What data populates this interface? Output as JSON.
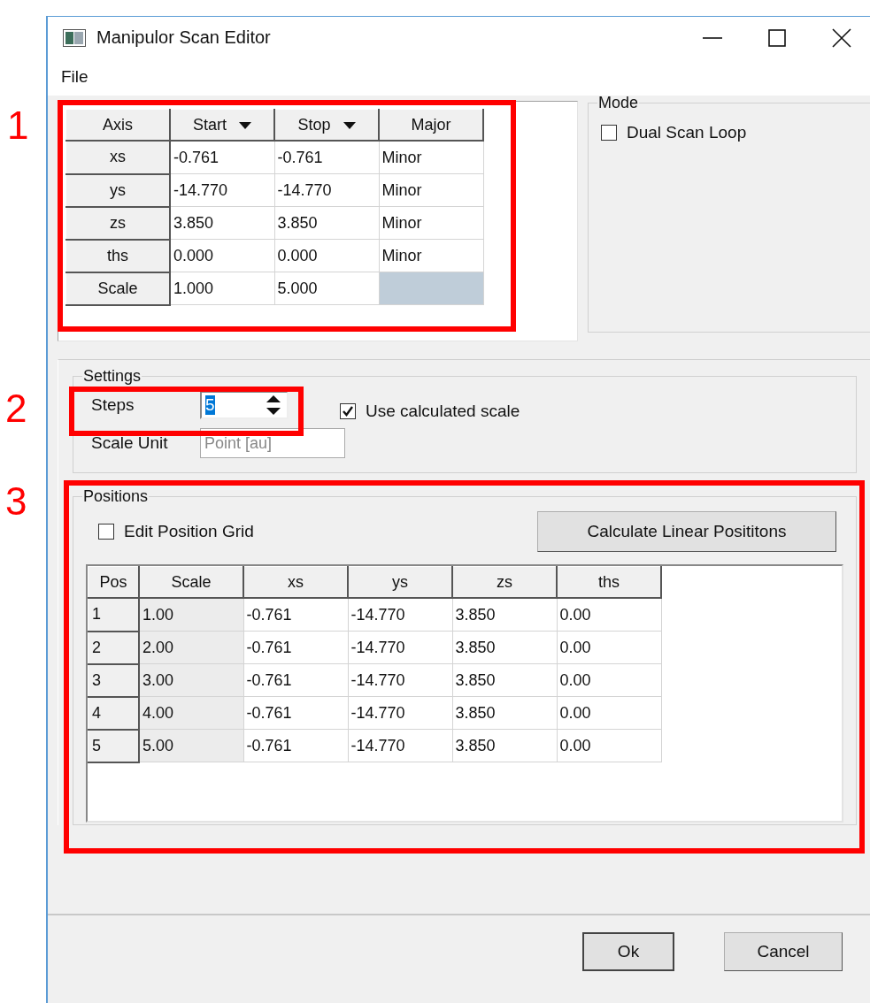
{
  "window": {
    "title": "Manipulor Scan Editor"
  },
  "menu": [
    {
      "label": "File"
    }
  ],
  "axis_table": {
    "columns": [
      {
        "label": "Axis",
        "sortable": false
      },
      {
        "label": "Start",
        "sortable": true
      },
      {
        "label": "Stop",
        "sortable": true
      },
      {
        "label": "Major",
        "sortable": false
      }
    ],
    "rows": [
      {
        "axis": "xs",
        "start": "-0.761",
        "stop": "-0.761",
        "major": "Minor",
        "selected": false
      },
      {
        "axis": "ys",
        "start": "-14.770",
        "stop": "-14.770",
        "major": "Minor",
        "selected": false
      },
      {
        "axis": "zs",
        "start": "3.850",
        "stop": "3.850",
        "major": "Minor",
        "selected": false
      },
      {
        "axis": "ths",
        "start": "0.000",
        "stop": "0.000",
        "major": "Minor",
        "selected": false
      },
      {
        "axis": "Scale",
        "start": "1.000",
        "stop": "5.000",
        "selected": true
      }
    ]
  },
  "mode": {
    "title": "Mode",
    "dual_scan_loop": {
      "label": "Dual Scan Loop",
      "checked": false
    }
  },
  "settings": {
    "title": "Settings",
    "steps": {
      "label": "Steps",
      "value": "5",
      "text_selected": true
    },
    "use_calculated_scale": {
      "label": "Use calculated scale",
      "checked": true
    },
    "scale_unit": {
      "label": "Scale Unit",
      "value": "Point [au]",
      "disabled": true
    }
  },
  "positions": {
    "title": "Positions",
    "edit_position_grid": {
      "label": "Edit Position Grid",
      "checked": false
    },
    "calculate_button": "Calculate Linear Posititons",
    "columns": [
      {
        "label": "Pos",
        "kind": "header"
      },
      {
        "label": "Scale",
        "kind": "readonly"
      },
      {
        "label": "xs",
        "kind": "value"
      },
      {
        "label": "ys",
        "kind": "value"
      },
      {
        "label": "zs",
        "kind": "value"
      },
      {
        "label": "ths",
        "kind": "value"
      }
    ],
    "rows": [
      [
        "1",
        "1.00",
        "-0.761",
        "-14.770",
        "3.850",
        "0.00"
      ],
      [
        "2",
        "2.00",
        "-0.761",
        "-14.770",
        "3.850",
        "0.00"
      ],
      [
        "3",
        "3.00",
        "-0.761",
        "-14.770",
        "3.850",
        "0.00"
      ],
      [
        "4",
        "4.00",
        "-0.761",
        "-14.770",
        "3.850",
        "0.00"
      ],
      [
        "5",
        "5.00",
        "-0.761",
        "-14.770",
        "3.850",
        "0.00"
      ]
    ]
  },
  "buttons": [
    {
      "label": "Ok",
      "default": true
    },
    {
      "label": "Cancel",
      "default": false
    }
  ],
  "annotations": [
    {
      "label": "1"
    },
    {
      "label": "2"
    },
    {
      "label": "3"
    }
  ]
}
